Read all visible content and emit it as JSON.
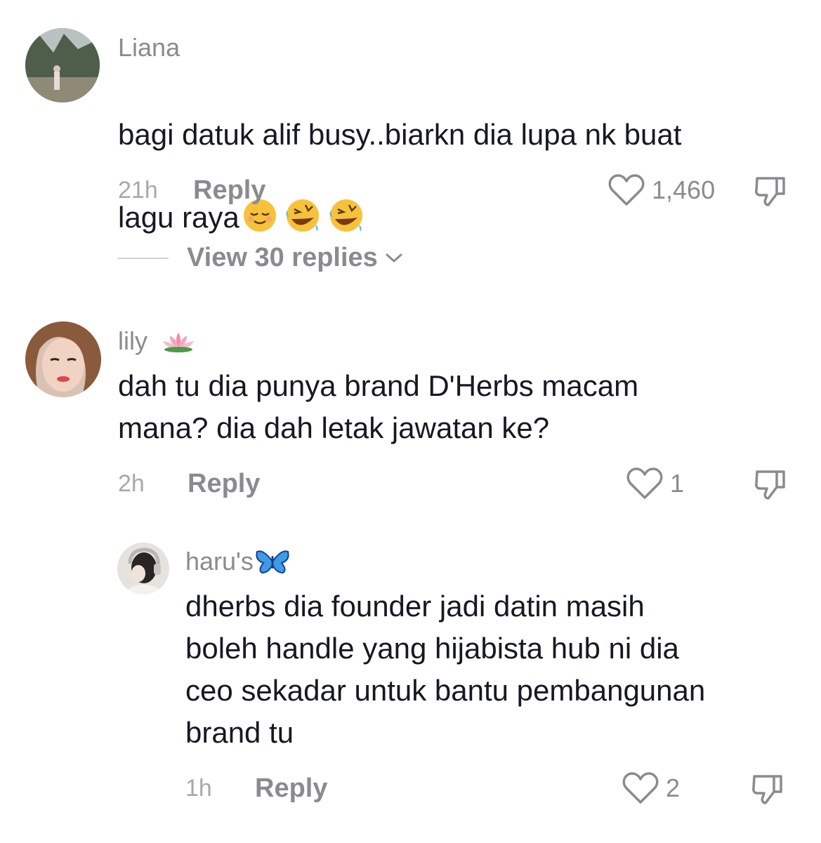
{
  "comments": [
    {
      "username": "Liana",
      "text": "bagi datuk alif busy..biarkn dia lupa nk buat\nlagu raya",
      "emojis": [
        "relieved-face",
        "rolling-on-floor-laughing",
        "rolling-on-floor-laughing"
      ],
      "time": "21h",
      "reply_label": "Reply",
      "likes": "1,460",
      "view_replies": "View 30 replies"
    },
    {
      "username": "lily",
      "username_emoji": "lotus",
      "text": "dah tu dia punya brand D'Herbs macam\nmana? dia dah letak jawatan ke?",
      "time": "2h",
      "reply_label": "Reply",
      "likes": "1"
    },
    {
      "username": "haru's",
      "username_emoji": "blue-butterfly",
      "text": "dherbs dia founder jadi datin masih\nboleh handle yang hijabista hub ni dia\nceo sekadar untuk bantu pembangunan\nbrand tu",
      "time": "1h",
      "reply_label": "Reply",
      "likes": "2"
    }
  ],
  "colors": {
    "primary_text": "#161823",
    "secondary_text": "#8a8b91",
    "muted_text": "#a7a8ad",
    "background": "#ffffff"
  }
}
